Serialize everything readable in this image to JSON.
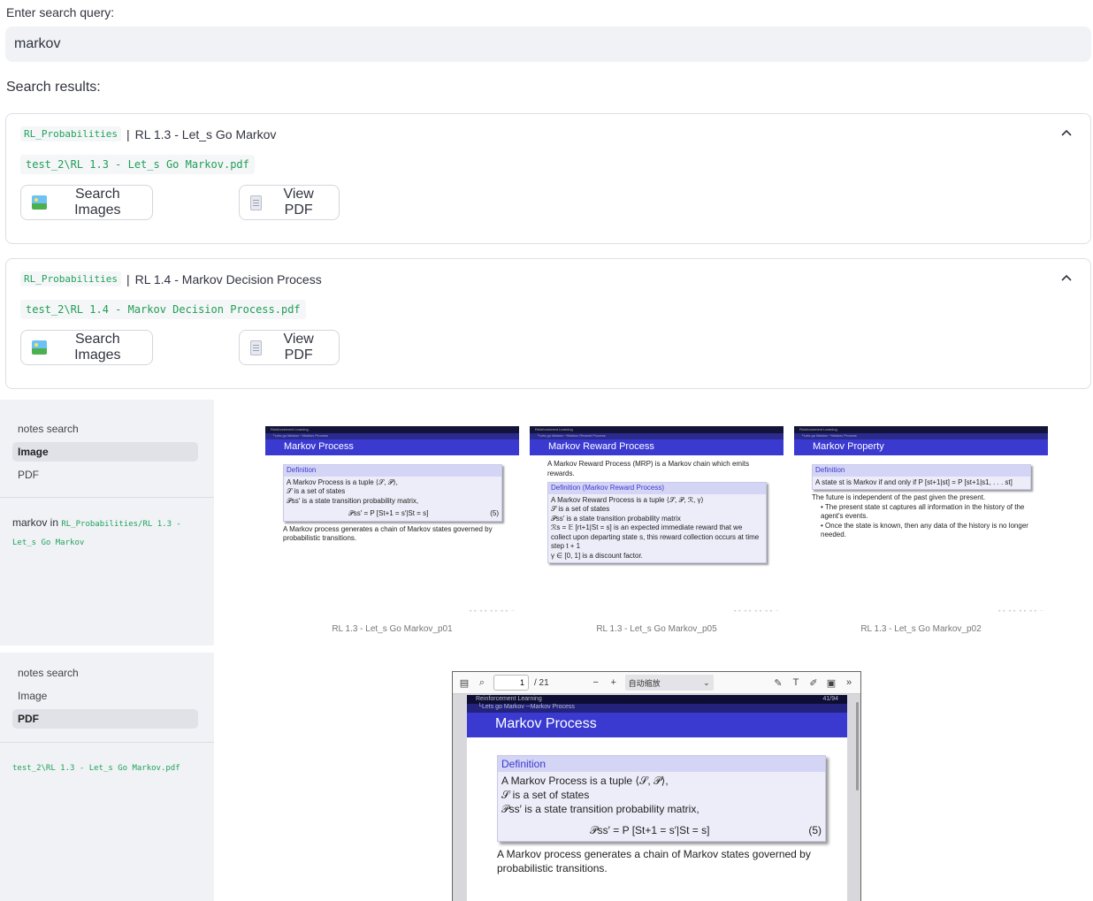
{
  "search": {
    "label": "Enter search query:",
    "value": "markov"
  },
  "results_label": "Search results:",
  "results": [
    {
      "tag": "RL_Probabilities",
      "title": "RL 1.3 - Let_s Go Markov",
      "path": "test_2\\RL 1.3 - Let_s Go Markov.pdf",
      "search_images": "Search Images",
      "view_pdf": "View PDF"
    },
    {
      "tag": "RL_Probabilities",
      "title": "RL 1.4 - Markov Decision Process",
      "path": "test_2\\RL 1.4 - Markov Decision Process.pdf",
      "search_images": "Search Images",
      "view_pdf": "View PDF"
    }
  ],
  "sidebar1": {
    "nav": [
      "notes search",
      "Image",
      "PDF"
    ],
    "active": "Image",
    "info_prefix": "markov in",
    "info_tag": "RL_Probabilities/RL 1.3 - Let_s Go Markov"
  },
  "sidebar2": {
    "nav": [
      "notes search",
      "Image",
      "PDF"
    ],
    "active": "PDF",
    "path": "test_2\\RL 1.3 - Let_s Go Markov.pdf"
  },
  "slides": [
    {
      "header_left": "Reinforcement Learning",
      "header_right": "41/94",
      "sub": "└Lets go Markov ─Markov Process",
      "title": "Markov Process",
      "def_head": "Definition",
      "lines": [
        "A Markov Process is a tuple ⟨𝒮, 𝒫⟩,",
        "𝒮 is a set of states",
        "𝒫ss′ is a state transition probability matrix,"
      ],
      "formula": "𝒫ss′ = P [St+1 = s′|St = s]",
      "eq": "(5)",
      "after": "A Markov process generates a chain of Markov states governed by probabilistic transitions.",
      "caption": "RL 1.3 - Let_s Go Markov_p01"
    },
    {
      "header_left": "Reinforcement Learning",
      "header_right": "45/94",
      "sub": "└Lets go Markov ─Markov Reward Process",
      "title": "Markov Reward Process",
      "intro": "A Markov Reward Process (MRP) is a Markov chain which emits rewards.",
      "def_head": "Definition (Markov Reward Process)",
      "lines": [
        "A Markov Reward Process is a tuple ⟨𝒮, 𝒫, ℛ, γ⟩",
        "𝒮 is a set of states",
        "𝒫ss′ is a state transition probability matrix",
        "ℛs = 𝔼 [rt+1|St = s] is an expected immediate reward that we collect upon departing state s, this reward collection occurs at time step t + 1",
        "γ ∈ [0, 1] is a discount factor."
      ],
      "caption": "RL 1.3 - Let_s Go Markov_p05"
    },
    {
      "header_left": "Reinforcement Learning",
      "header_right": "42/94",
      "sub": "└Lets go Markov ─Markov Process",
      "title": "Markov Property",
      "def_head": "Definition",
      "lines": [
        "A state st is Markov if and only if P [st+1|st] = P [st+1|s1, . . . st]"
      ],
      "after": "The future is independent of the past given the present.",
      "bullets": [
        "The present state st captures all information in the history of the agent's events.",
        "Once the state is known, then any data of the history is no longer needed."
      ],
      "caption": "RL 1.3 - Let_s Go Markov_p02"
    }
  ],
  "viewer": {
    "page": "1",
    "total": "/ 21",
    "zoom": "自动缩放",
    "header_left": "Reinforcement Learning",
    "header_right": "41/94",
    "sub": "└Lets go Markov ─Markov Process",
    "title": "Markov Process",
    "def_head": "Definition",
    "lines": [
      "A Markov Process is a tuple ⟨𝒮, 𝒫⟩,",
      "𝒮 is a set of states",
      "𝒫ss′ is a state transition probability matrix,"
    ],
    "formula": "𝒫ss′ = P [St+1 = s′|St = s]",
    "eq": "(5)",
    "after": "A Markov process generates a chain of Markov states governed by probabilistic transitions."
  }
}
